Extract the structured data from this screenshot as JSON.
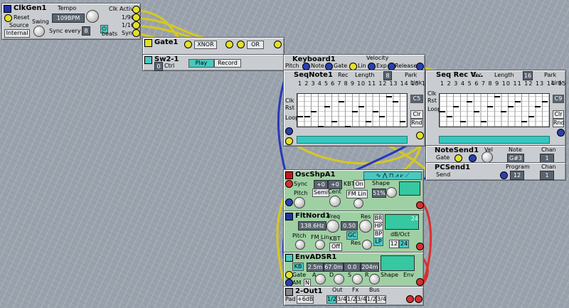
{
  "clkgen": {
    "title": "ClkGen1",
    "reset": "Reset",
    "tempo_label": "Tempo",
    "tempo_value": "109BPM",
    "clk_label": "Clk",
    "active_label": "Active",
    "div1": "1/96",
    "div2": "1/16",
    "sync_label": "Sync",
    "source_label": "Source",
    "source_value": "Internal",
    "swing_label": "Swing",
    "sync_every_label": "Sync every",
    "sync_every_value": "8",
    "beats_label": "beats",
    "power_icon": "power-icon"
  },
  "gate": {
    "title": "Gate1",
    "mode1": "XNOR",
    "mode2": "OR"
  },
  "sw": {
    "title": "Sw2-1",
    "ctrl_label": "Ctrl",
    "ctrl_value": "0",
    "play": "Play",
    "record": "Record"
  },
  "keyboard": {
    "title": "Keyboard1",
    "pitch": "Pitch",
    "note": "Note",
    "gate": "Gate",
    "velocity_label": "Velocity",
    "lin": "Lin",
    "exp": "Exp",
    "release": "Release"
  },
  "seqnote": {
    "title": "SeqNote1",
    "rec": "Rec",
    "length_label": "Length",
    "length_value": "8",
    "park": "Park",
    "link": "Link",
    "clk": "Clk",
    "rst": "Rst",
    "loop": "Loop",
    "range": "C5",
    "clr": "Clr",
    "rnd": "Rnd",
    "steps": [
      "1",
      "2",
      "3",
      "4",
      "5",
      "6",
      "7",
      "8",
      "9",
      "10",
      "11",
      "12",
      "13",
      "14",
      "15",
      "16"
    ]
  },
  "seqrec": {
    "title": "Seq Rec V...",
    "rec": "Rec",
    "length_label": "Length",
    "length_value": "16",
    "park": "Park",
    "link": "Link",
    "clk": "Clk",
    "rst": "Rst",
    "loop": "Loop",
    "range": "C9",
    "clr": "Clr",
    "rnd": "Rnd",
    "steps": [
      "1",
      "2",
      "3",
      "4",
      "5",
      "6",
      "7",
      "8",
      "9",
      "10",
      "11",
      "12",
      "13",
      "14",
      "15",
      "16"
    ]
  },
  "notesend": {
    "title": "NoteSend1",
    "vel": "Vel",
    "note": "Note",
    "chan_label": "Chan",
    "chan_value": "1",
    "gate": "Gate",
    "note_value": "G#3"
  },
  "pcsend": {
    "title": "PCSend1",
    "send": "Send",
    "program_label": "Program",
    "program_value": "12",
    "chan_label": "Chan",
    "chan_value": "1"
  },
  "osc": {
    "title": "OscShpA1",
    "sync": "Sync",
    "plus0": "+0",
    "plus0b": "+0",
    "kbt": "KBT",
    "on": "On",
    "pitch": "Pitch",
    "semi": "Semi",
    "cent": "Cent",
    "fmlin": "FM Lin",
    "shape_label": "Shape",
    "shape_value": "51%"
  },
  "filt": {
    "title": "FltNord1",
    "freq_label": "Freq",
    "freq_value": "138.6Hz",
    "res_label": "Res",
    "res_value": "0.50",
    "pitch": "Pitch",
    "fm_lin": "FM Lin",
    "kbt": "KBT",
    "off": "Off",
    "gc": "GC",
    "res2": "Res",
    "br": "BR",
    "hp": "HP",
    "bp": "BP",
    "lp": "LP",
    "db_label": "dB/Oct",
    "db12": "12",
    "db24": "24",
    "slope": "24"
  },
  "env": {
    "title": "EnvADSR1",
    "kb": "KB",
    "a_value": "2.5m",
    "d_value": "67.0m",
    "s_value": "0.0",
    "r_value": "204m",
    "gate": "Gate",
    "a": "A",
    "d": "D",
    "s": "S",
    "r": "R",
    "am": "AM",
    "n": "N",
    "shape_label": "Shape",
    "env_label": "Env"
  },
  "out": {
    "title": "2-Out1",
    "pad_label": "Pad",
    "pad_value": "+6dB",
    "out_label": "Out",
    "fx_label": "Fx",
    "bus_label": "Bus",
    "pairs": [
      "1/2",
      "3/4",
      "1/2",
      "3/4",
      "1/2",
      "3/4"
    ]
  },
  "colors": {
    "cable_yellow": "#d8c820",
    "cable_blue": "#2838b8",
    "module_grey": "#c9ccd0",
    "module_green": "#9fd0a4"
  },
  "seq_notes": [
    [
      1,
      4
    ],
    [
      2,
      4
    ],
    [
      3,
      3
    ],
    [
      4,
      6
    ],
    [
      5,
      2
    ],
    [
      6,
      5
    ],
    [
      7,
      1
    ],
    [
      8,
      6
    ],
    [
      9,
      3
    ],
    [
      10,
      2
    ],
    [
      11,
      5
    ],
    [
      12,
      3
    ],
    [
      13,
      4
    ],
    [
      14,
      0
    ],
    [
      15,
      1
    ],
    [
      16,
      5
    ]
  ],
  "rec_notes": [
    [
      1,
      3
    ],
    [
      2,
      4
    ],
    [
      3,
      2
    ],
    [
      4,
      5
    ],
    [
      5,
      1
    ],
    [
      6,
      3
    ],
    [
      7,
      5
    ],
    [
      8,
      2
    ],
    [
      9,
      0
    ],
    [
      10,
      3
    ],
    [
      11,
      2
    ],
    [
      12,
      1
    ],
    [
      13,
      5
    ],
    [
      14,
      4
    ],
    [
      15,
      2
    ],
    [
      16,
      1
    ]
  ]
}
